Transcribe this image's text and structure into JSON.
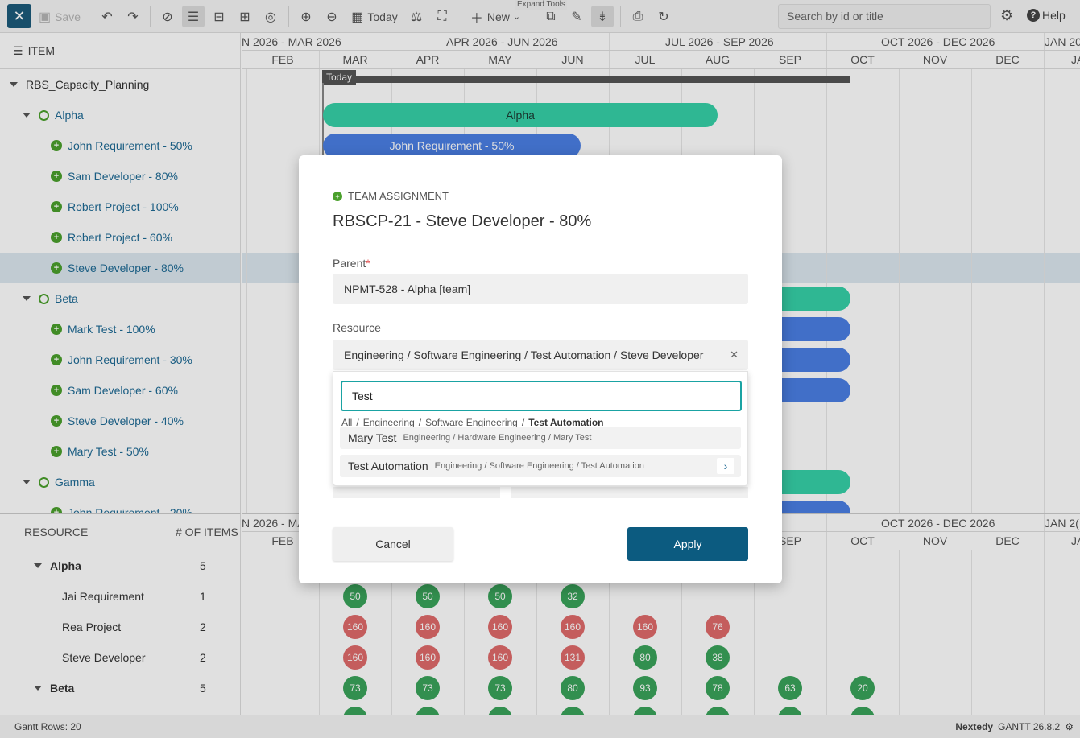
{
  "toolbar": {
    "save_label": "Save",
    "today_label": "Today",
    "new_label": "New",
    "expand_tools_tip": "Expand Tools",
    "search_placeholder": "Search by id or title",
    "help_label": "Help"
  },
  "left": {
    "header": "ITEM",
    "rows": [
      {
        "label": "RBS_Capacity_Planning"
      },
      {
        "label": "Alpha"
      },
      {
        "label": "John Requirement - 50%"
      },
      {
        "label": "Sam Developer - 80%"
      },
      {
        "label": "Robert Project - 100%"
      },
      {
        "label": "Robert Project - 60%"
      },
      {
        "label": "Steve Developer - 80%"
      },
      {
        "label": "Beta"
      },
      {
        "label": "Mark Test - 100%"
      },
      {
        "label": "John Requirement - 30%"
      },
      {
        "label": "Sam Developer - 60%"
      },
      {
        "label": "Steve Developer - 40%"
      },
      {
        "label": "Mary Test - 50%"
      },
      {
        "label": "Gamma"
      },
      {
        "label": "John Requirement - 20%"
      }
    ]
  },
  "timeline": {
    "quarters": [
      "N 2026 - MAR 2026",
      "APR 2026 - JUN 2026",
      "JUL 2026 - SEP 2026",
      "OCT 2026 - DEC 2026",
      "JAN 20"
    ],
    "months": [
      "FEB",
      "MAR",
      "APR",
      "MAY",
      "JUN",
      "JUL",
      "AUG",
      "SEP",
      "OCT",
      "NOV",
      "DEC",
      "JA"
    ],
    "today_tag": "Today",
    "bottom_quarters": [
      "N 2026 - MA",
      "OCT 2026 - DEC 2026",
      "JAN 2("
    ],
    "bottom_months": [
      "FEB",
      "SEP",
      "OCT",
      "NOV",
      "DEC",
      "JA"
    ]
  },
  "bars": {
    "alpha": "Alpha",
    "john": "John Requirement - 50%"
  },
  "resources": {
    "header_resource": "RESOURCE",
    "header_items": "# OF ITEMS",
    "rows": [
      {
        "name": "Alpha",
        "count": "5"
      },
      {
        "name": "Jai Requirement",
        "count": "1"
      },
      {
        "name": "Rea Project",
        "count": "2"
      },
      {
        "name": "Steve Developer",
        "count": "2"
      },
      {
        "name": "Beta",
        "count": "5"
      }
    ],
    "badges": {
      "jai": [
        "50",
        "50",
        "50",
        "32"
      ],
      "rea": [
        "160",
        "160",
        "160",
        "160",
        "160",
        "76"
      ],
      "steve": [
        "160",
        "160",
        "160",
        "131",
        "80",
        "38"
      ],
      "beta": [
        "73",
        "73",
        "73",
        "80",
        "93",
        "78",
        "63",
        "20"
      ]
    }
  },
  "status": {
    "rows": "Gantt Rows: 20",
    "brand": "Nextedy",
    "version": "GANTT 26.8.2"
  },
  "modal": {
    "type": "TEAM ASSIGNMENT",
    "title": "RBSCP-21 - Steve Developer - 80%",
    "parent_label": "Parent",
    "parent_required": "*",
    "parent_value": "NPMT-528 - Alpha [team]",
    "resource_label": "Resource",
    "resource_value": "Engineering / Software Engineering / Test Automation / Steve Developer",
    "search_value": "Test",
    "crumbs": [
      "All",
      "Engineering",
      "Software Engineering",
      "Test Automation"
    ],
    "options": [
      {
        "name": "Mary Test",
        "path": "Engineering / Hardware Engineering / Mary Test"
      },
      {
        "name": "Test Automation",
        "path": "Engineering / Software Engineering / Test Automation"
      }
    ],
    "cancel_label": "Cancel",
    "apply_label": "Apply"
  },
  "colors": {
    "accent": "#0c5b80",
    "teal_bar": "#36d1a8",
    "blue_bar": "#4b7fe4",
    "badge_green": "#3aa35a",
    "badge_red": "#e06a6a",
    "focus": "#1aa3a3"
  }
}
